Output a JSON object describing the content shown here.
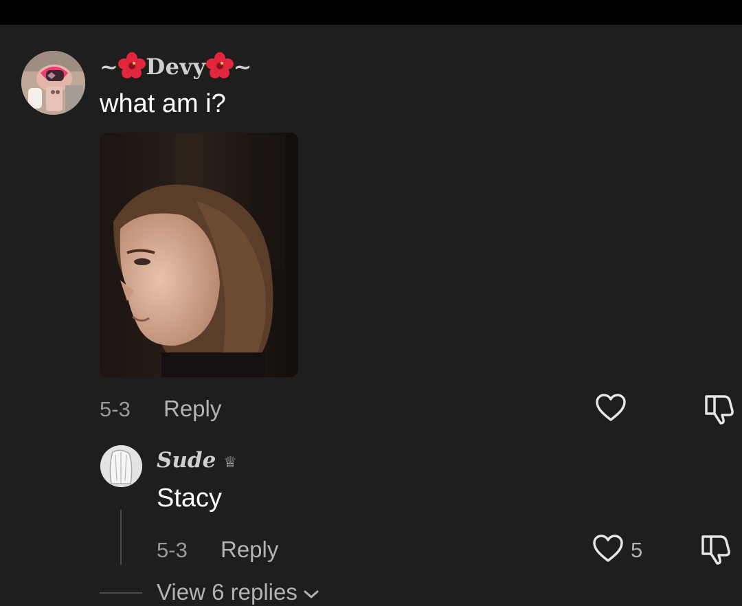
{
  "colors": {
    "background": "#1e1e1f",
    "top_bar": "#000000",
    "text_primary": "#ffffff",
    "text_secondary": "#9a9a9b",
    "username": "#cfcfcf",
    "flower": "#e2263b"
  },
  "comment": {
    "username_prefix": "~",
    "username_core": "Devy",
    "username_suffix": "~",
    "username_emoji": "hibiscus",
    "text": "what am i?",
    "date": "5-3",
    "reply_label": "Reply",
    "like_icon": "heart-outline-icon",
    "dislike_icon": "thumbs-down-outline-icon"
  },
  "reply": {
    "username": "Sude",
    "badge": "♕",
    "text": "Stacy",
    "date": "5-3",
    "reply_label": "Reply",
    "like_count": "5",
    "like_icon": "heart-outline-icon",
    "dislike_icon": "thumbs-down-outline-icon"
  },
  "view_replies": {
    "label": "View 6 replies",
    "icon": "chevron-down-icon"
  }
}
